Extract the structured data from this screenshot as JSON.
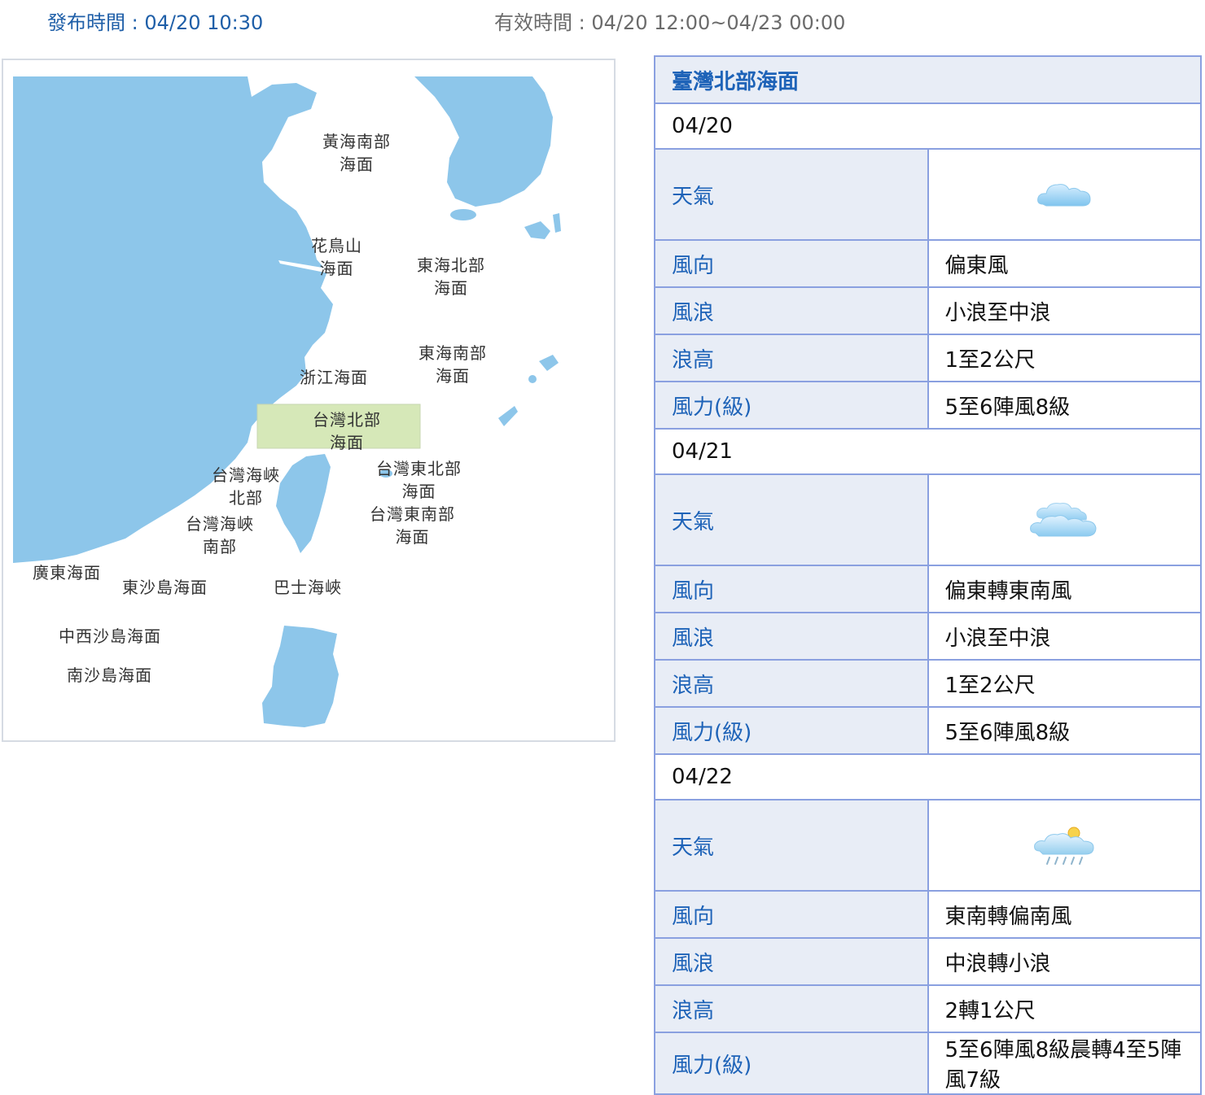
{
  "header": {
    "issued": "發布時間 : 04/20 10:30",
    "valid": "有效時間 : 04/20 12:00~04/23 00:00"
  },
  "map": {
    "labels": [
      "黃海南部\n海面",
      "花鳥山\n海面",
      "東海北部\n海面",
      "東海南部\n海面",
      "浙江海面",
      "台灣北部\n海面",
      "台灣海峽\n北部",
      "台灣東北部\n海面",
      "台灣海峽\n南部",
      "台灣東南部\n海面",
      "廣東海面",
      "東沙島海面",
      "巴士海峽",
      "中西沙島海面",
      "南沙島海面"
    ],
    "colors": {
      "land": "#ffffff",
      "sea": "#8dc6ea",
      "highlight": "#d6e8b8"
    }
  },
  "forecast": {
    "title": "臺灣北部海面",
    "row_labels": {
      "weather": "天氣",
      "wind_dir": "風向",
      "wind_wave": "風浪",
      "wave_height": "浪高",
      "wind_force": "風力(級)"
    },
    "days": [
      {
        "date": "04/20",
        "weather_icon": "cloudy-icon",
        "wind_dir": "偏東風",
        "wind_wave": "小浪至中浪",
        "wave_height": "1至2公尺",
        "wind_force": "5至6陣風8級"
      },
      {
        "date": "04/21",
        "weather_icon": "overcast-icon",
        "wind_dir": "偏東轉東南風",
        "wind_wave": "小浪至中浪",
        "wave_height": "1至2公尺",
        "wind_force": "5至6陣風8級"
      },
      {
        "date": "04/22",
        "weather_icon": "cloudy-showers-sun-icon",
        "wind_dir": "東南轉偏南風",
        "wind_wave": "中浪轉小浪",
        "wave_height": "2轉1公尺",
        "wind_force": "5至6陣風8級晨轉4至5陣風7級"
      }
    ]
  }
}
